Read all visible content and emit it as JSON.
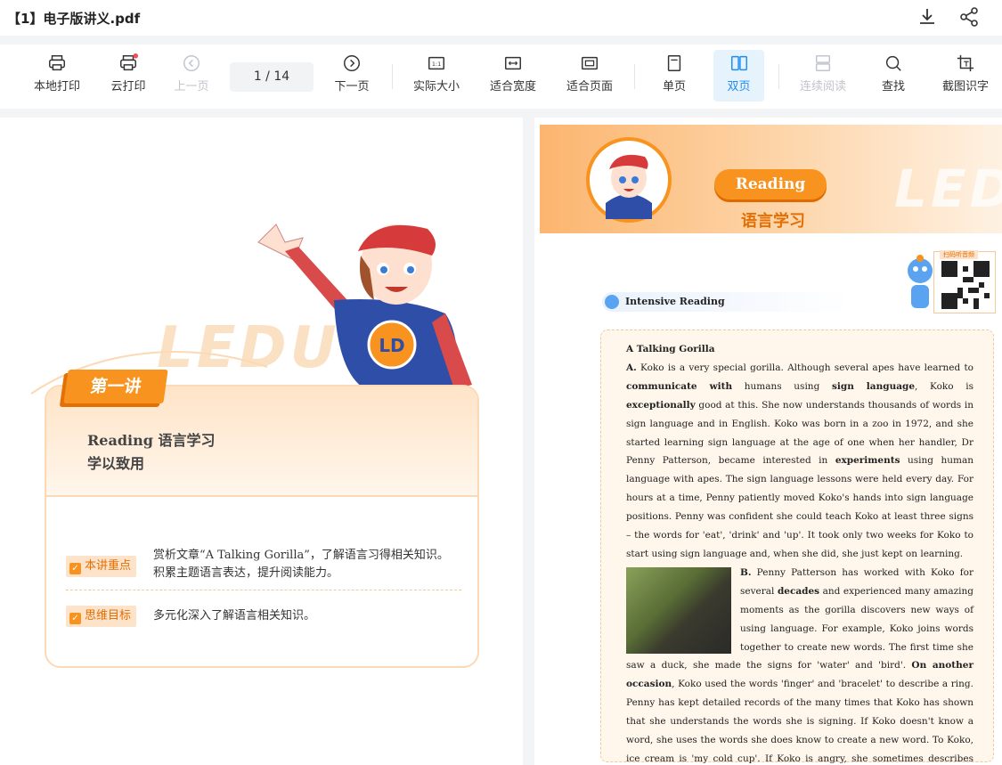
{
  "file": {
    "title": "【1】电子版讲义.pdf"
  },
  "toolbar": {
    "local_print": "本地打印",
    "cloud_print": "云打印",
    "prev_page": "上一页",
    "page_indicator": "1  / 14",
    "next_page": "下一页",
    "actual_size": "实际大小",
    "fit_width": "适合宽度",
    "fit_page": "适合页面",
    "single_page": "单页",
    "double_page": "双页",
    "continuous": "连续阅读",
    "find": "查找",
    "ocr": "截图识字"
  },
  "left_page": {
    "ribbon": "第一讲",
    "card_title_line1": "Reading  语言学习",
    "card_title_line2": "学以致用",
    "tag1": "本讲重点",
    "tag1_text_line1": "赏析文章“A Talking Gorilla”，了解语言习得相关知识。",
    "tag1_text_line2": "积累主题语言表达，提升阅读能力。",
    "tag2": "思维目标",
    "tag2_text": "多元化深入了解语言相关知识。",
    "watermark": "LEDU"
  },
  "right_page": {
    "header_button": "Reading",
    "header_sub": "语言学习",
    "watermark": "LEDU",
    "section_label": "Intensive Reading",
    "qr_caption": "扫码听音频",
    "article_title": "A Talking Gorilla",
    "para_a_label": "A.",
    "para_b_label": "B."
  },
  "colors": {
    "accent": "#f7931e",
    "active_blue": "#1f8cf0",
    "disabled": "#c0c4cc"
  }
}
